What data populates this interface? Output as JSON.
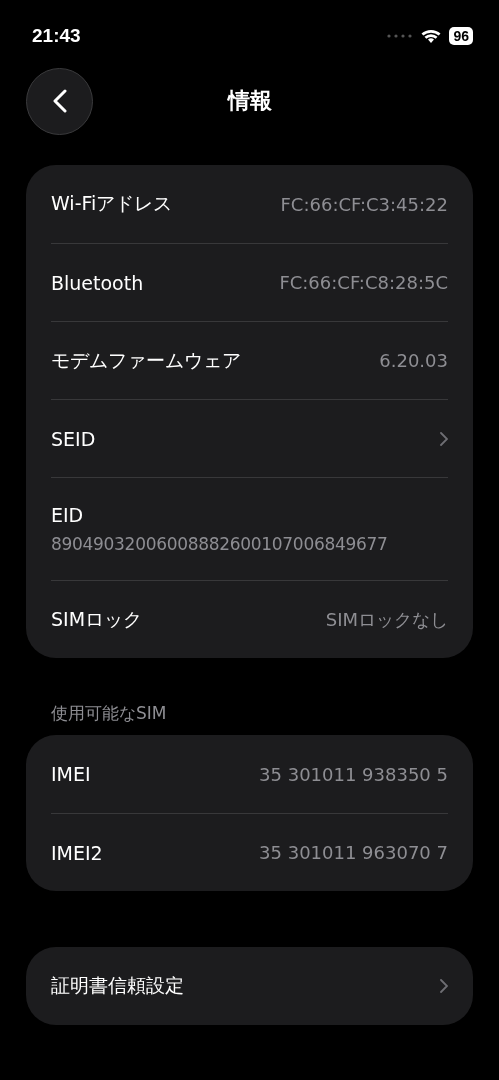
{
  "status_bar": {
    "time": "21:43",
    "battery": "96"
  },
  "header": {
    "title": "情報"
  },
  "groups": [
    {
      "rows": [
        {
          "kind": "value",
          "label": "Wi-Fiアドレス",
          "value": "FC:66:CF:C3:45:22"
        },
        {
          "kind": "value",
          "label": "Bluetooth",
          "value": "FC:66:CF:C8:28:5C"
        },
        {
          "kind": "value",
          "label": "モデムファームウェア",
          "value": "6.20.03"
        },
        {
          "kind": "link",
          "label": "SEID"
        },
        {
          "kind": "stacked",
          "label": "EID",
          "value": "89049032006008882600107006849677"
        },
        {
          "kind": "value",
          "label": "SIMロック",
          "value": "SIMロックなし"
        }
      ]
    },
    {
      "heading": "使用可能なSIM",
      "rows": [
        {
          "kind": "value",
          "label": "IMEI",
          "value": "35 301011 938350 5"
        },
        {
          "kind": "value",
          "label": "IMEI2",
          "value": "35 301011 963070 7"
        }
      ]
    },
    {
      "rows": [
        {
          "kind": "link",
          "label": "証明書信頼設定"
        }
      ]
    }
  ]
}
